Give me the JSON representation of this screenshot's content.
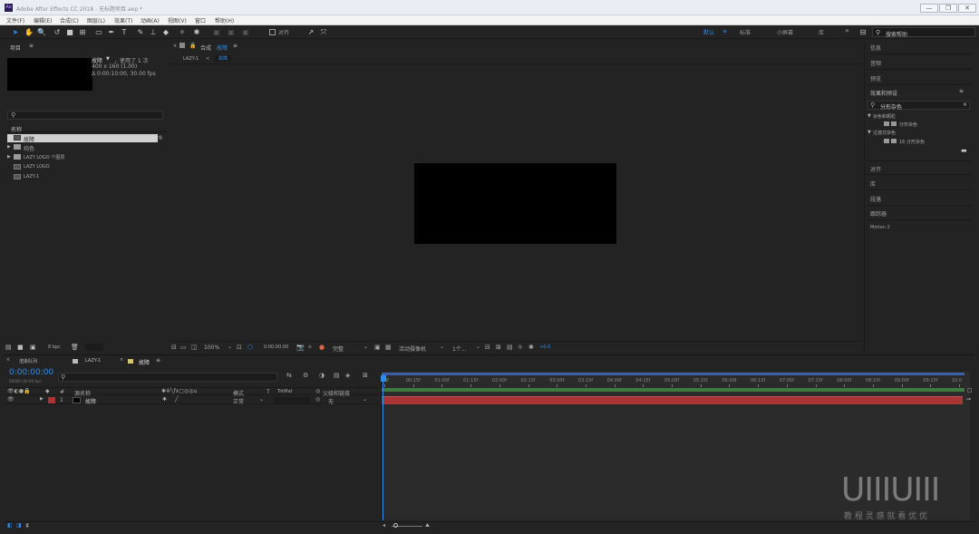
{
  "window": {
    "title": "Adobe After Effects CC 2018 - 无标题项目.aep *",
    "logo": "Ae",
    "buttons": [
      "—",
      "❐",
      "✕"
    ]
  },
  "menu": [
    "文件(F)",
    "编辑(E)",
    "合成(C)",
    "图层(L)",
    "效果(T)",
    "动画(A)",
    "视图(V)",
    "窗口",
    "帮助(H)"
  ],
  "toolbar": {
    "snap_label": "对齐",
    "workspaces": [
      "默认",
      "≡",
      "标准",
      "小屏幕",
      "库"
    ],
    "search_placeholder": "搜索帮助",
    "more": "»"
  },
  "project": {
    "panel_title": "项目",
    "item_name": "故障",
    "item_used": "，使用了 1 次",
    "item_dims": "400 x 160 (1.00)",
    "item_time": "Δ 0:00:10:00, 30.00 fps",
    "search_placeholder": "",
    "col_name": "名称",
    "items": [
      {
        "label": "故障",
        "icon": "composition-icon",
        "selected": true
      },
      {
        "label": "纯色",
        "icon": "folder-icon",
        "selected": false
      },
      {
        "label": "LAZY LOGO 个图层",
        "icon": "folder-icon",
        "selected": false
      },
      {
        "label": "LAZY LOGO",
        "icon": "composition-icon",
        "selected": false
      },
      {
        "label": "LAZY-1",
        "icon": "composition-icon",
        "selected": false
      }
    ],
    "bpc": "8 bpc"
  },
  "comp": {
    "panel_title": "合成",
    "comp_name": "故障",
    "breadcrumbs": [
      "LAZY-1",
      "故障"
    ],
    "zoom": "100%",
    "timecode": "0:00:00:00",
    "quality": "完整",
    "camera": "活动摄像机",
    "views": "1个...",
    "exposure": "+0.0"
  },
  "right_panel": {
    "items": [
      "信息",
      "音频",
      "预览"
    ],
    "effects_title": "效果和预设",
    "effects_search": "分形杂色",
    "tree": [
      {
        "label": "杂色和颗粒",
        "level": 0
      },
      {
        "label": "分形杂色",
        "level": 1
      },
      {
        "label": "过渡式杂色",
        "level": 0
      },
      {
        "label": "16 分形杂色",
        "level": 1
      }
    ],
    "items2": [
      "对齐",
      "库",
      "段落",
      "跟踪器",
      "Motion 2"
    ]
  },
  "timeline": {
    "tabs": [
      "渲染队列",
      "LAZY-1",
      "故障"
    ],
    "timecode": "0:00:00:00",
    "timecode_sub": "00000 (30.00 fps)",
    "search_placeholder": "",
    "col_headers": [
      "#",
      "源名称",
      "模式",
      "T",
      "TrkMat",
      "父级和链接"
    ],
    "layer": {
      "index": "1",
      "name": "故障",
      "mode": "正常",
      "parent": "无"
    },
    "ticks": [
      "0f",
      "00:15f",
      "01:00f",
      "01:15f",
      "02:00f",
      "02:15f",
      "03:00f",
      "03:15f",
      "04:00f",
      "04:15f",
      "05:00f",
      "05:15f",
      "06:00f",
      "06:15f",
      "07:00f",
      "07:15f",
      "08:00f",
      "08:15f",
      "09:00f",
      "09:15f",
      "10:0"
    ]
  },
  "watermark": {
    "logo": "UIIIUIII",
    "caption": "教 程 灵 感 就 看 优 优"
  },
  "colors": {
    "accent": "#2d8ceb",
    "layer_bar": "#a83434",
    "work_area": "#3f7a3f"
  }
}
